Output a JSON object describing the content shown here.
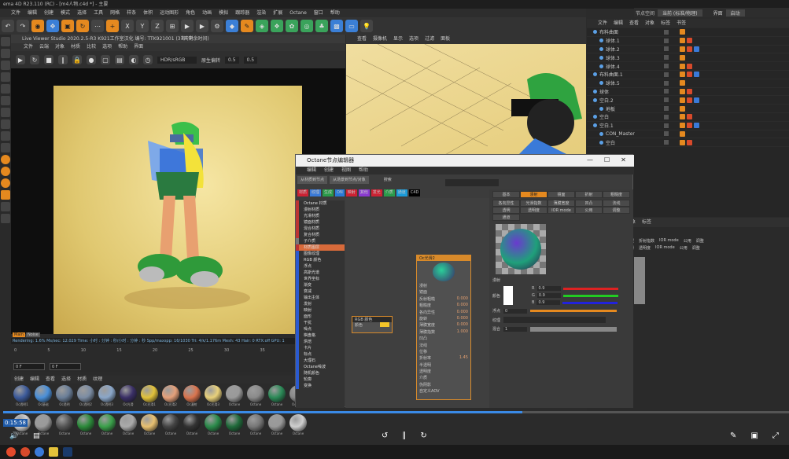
{
  "app_title": "ema 4D R23.110 (RC) - [m4人物.c4d *] - 主要",
  "menu": [
    "文件",
    "编辑",
    "创建",
    "模式",
    "选择",
    "工具",
    "网格",
    "样条",
    "体积",
    "运动图形",
    "角色",
    "动画",
    "模拟",
    "跟踪器",
    "渲染",
    "扩展",
    "Octane",
    "窗口",
    "帮助"
  ],
  "top_right": {
    "node_space_label": "节点空间",
    "node_space_value": "当前 (标准/物理)",
    "layout_label": "界面",
    "layout_value": "启动"
  },
  "lvs": {
    "title": "Live Viewer Studio 2020.2.5-R3  K921工作室汉化  编号: TTK921001  (37天剩余时间)",
    "menu": [
      "文件",
      "云端",
      "对象",
      "材质",
      "比较",
      "选项",
      "帮助",
      "界面"
    ],
    "toolbar": {
      "hint": "指令中",
      "color_mode": "HDR/sRGB",
      "mode_label": "原生偏转",
      "val1": "0.5",
      "val2": "0.5"
    },
    "noise_tags": [
      "Main",
      "Noise"
    ],
    "status": "Rendering: 1.6%   Ms/sec: 12.029   Time: 小时 : 分钟 : 秒/小时 : 分钟 : 秒   Spp/maxspp: 16/1030   Tri: 4/k/1.176m   Mesh: 43   Hair: 0   RTX:off   GPU: 1"
  },
  "timeline": {
    "ticks": [
      "0",
      "5",
      "10",
      "15",
      "20",
      "25",
      "30",
      "35",
      "40",
      "45"
    ],
    "frame_start": "0 F",
    "frame_cur": "0 F"
  },
  "mat_menu": [
    "创建",
    "编辑",
    "查看",
    "选择",
    "材质",
    "纹理"
  ],
  "materials": [
    {
      "name": "Oc透明1",
      "color": "#3c5a9a"
    },
    {
      "name": "Oc基础",
      "color": "#4a8fd8"
    },
    {
      "name": "Oc透明",
      "color": "#6a7e98"
    },
    {
      "name": "Oc透明2",
      "color": "#7b8ca3"
    },
    {
      "name": "Oc透明3",
      "color": "#8aa6c8"
    },
    {
      "name": "Oc光滑",
      "color": "#3a2f66"
    },
    {
      "name": "Oc光滑1",
      "color": "#e2c23a"
    },
    {
      "name": "Oc光滑2",
      "color": "#e5a07a"
    },
    {
      "name": "Oc漫射",
      "color": "#d9744e"
    },
    {
      "name": "Oc光滑3",
      "color": "#e8d07a"
    },
    {
      "name": "Octane",
      "color": "#9a9a9a"
    },
    {
      "name": "Octane",
      "color": "#8a8a8a"
    },
    {
      "name": "Octane",
      "color": "#2b8a57"
    },
    {
      "name": "Oc光滑4",
      "color": "#888"
    }
  ],
  "materials_row2": [
    {
      "name": "Octane",
      "color": "#cfcfcf"
    },
    {
      "name": "Octane",
      "color": "#9a9a9a"
    },
    {
      "name": "Octane",
      "color": "#555"
    },
    {
      "name": "Octane",
      "color": "#2b8a3a"
    },
    {
      "name": "Octane",
      "color": "#3aa04a"
    },
    {
      "name": "Octane",
      "color": "#aaa"
    },
    {
      "name": "Octane",
      "color": "#e8c070"
    },
    {
      "name": "Octane",
      "color": "#444"
    },
    {
      "name": "Octane",
      "color": "#333"
    },
    {
      "name": "Octane",
      "color": "#2a8a4a"
    },
    {
      "name": "Octane",
      "color": "#1f6a3a"
    },
    {
      "name": "Octane",
      "color": "#777"
    },
    {
      "name": "Octane",
      "color": "#999"
    },
    {
      "name": "Octane",
      "color": "#cfcfcf"
    }
  ],
  "viewport": {
    "menu": [
      "查看",
      "摄像机",
      "显示",
      "选项",
      "过滤",
      "面板"
    ]
  },
  "objects": {
    "tabs": [
      "文件",
      "编辑",
      "查看",
      "对象",
      "标签",
      "书签"
    ],
    "rows": [
      {
        "name": "布料曲面",
        "indent": 0
      },
      {
        "name": "球体.1",
        "indent": 1
      },
      {
        "name": "球体.2",
        "indent": 1
      },
      {
        "name": "球体.3",
        "indent": 1
      },
      {
        "name": "球体.4",
        "indent": 1
      },
      {
        "name": "布料曲面.1",
        "indent": 0
      },
      {
        "name": "球体.5",
        "indent": 1
      },
      {
        "name": "球体",
        "indent": 0
      },
      {
        "name": "空白.2",
        "indent": 0
      },
      {
        "name": "地板",
        "indent": 1
      },
      {
        "name": "空白",
        "indent": 0
      },
      {
        "name": "空白.1",
        "indent": 0
      },
      {
        "name": "CON_Master",
        "indent": 1
      },
      {
        "name": "空白",
        "indent": 1
      }
    ]
  },
  "attr_panel": {
    "tabs": [
      "基本",
      "坐标",
      "对象",
      "标签"
    ],
    "row1": [
      "模型",
      "折射指数",
      "IOR mode",
      "公用",
      "调整"
    ],
    "row2": [
      "漫射",
      "透明度",
      "IOR mode",
      "公用",
      "调整"
    ]
  },
  "node_editor": {
    "title": "Octane节点编辑器",
    "menu": [
      "编辑",
      "创建",
      "视图",
      "帮助"
    ],
    "buttons": [
      "从材质到节点",
      "从场景到节点/对象",
      "搜索"
    ],
    "tabs": [
      "材质",
      "纹理",
      "生成",
      "ON",
      "映射",
      "其他",
      "发光",
      "介质",
      "通道",
      "C4D"
    ],
    "categories": [
      "Octane 材质",
      "漫射材质",
      "光滑材质",
      "镜面材质",
      "混合材质",
      "复合材质",
      "子介质",
      "材质图层",
      "图像纹理",
      "RGB 颜色",
      "浮点",
      "高斯光谱",
      "世界坐标",
      "渐变",
      "衰减",
      "输出主体",
      "发射",
      "映射",
      "面形",
      "干扰",
      "噪点",
      "棋盘格",
      "烘焙",
      "卡片",
      "标点",
      "大理石",
      "Octane噪波",
      "随机颜色",
      "轮廓",
      "变换"
    ],
    "rgb_node": {
      "title": "RGB 颜色",
      "field": "颜色"
    },
    "main_node": {
      "title": "Oc光滑2",
      "rows": [
        "漫射",
        "镜面",
        "反射粗糙",
        "粗糙度",
        "各向异性",
        "旋转",
        "薄膜宽度",
        "薄膜指数",
        "凹凸",
        "法线",
        "位移",
        "折射率",
        "半透明",
        "透明度",
        "介质",
        "伪阴影",
        "自定义AOV"
      ],
      "values": [
        "",
        "",
        "0.000",
        "0.000",
        "0.000",
        "0.000",
        "0.000",
        "1.000",
        "",
        "",
        "",
        "1.45",
        "",
        "",
        "",
        "",
        ""
      ]
    },
    "right_tabs_row1": [
      "基本",
      "漫射",
      "镜面",
      "折射",
      "粗糙度"
    ],
    "right_tabs_row2": [
      "各向异性",
      "光滑指数",
      "薄膜宽度",
      "凹凸",
      "法线"
    ],
    "right_tabs_row3": [
      "透明",
      "透明度",
      "IOR mode",
      "公用",
      "调整"
    ],
    "right_tabs_row4": [
      "通道"
    ],
    "section": "漫射",
    "color_label": "颜色",
    "r": "0.9",
    "g": "0.9",
    "b": "0.9",
    "float_label": "浮点",
    "float_value": "0",
    "texture_label": "纹理",
    "mix_label": "混合",
    "mix_value": "1"
  },
  "player": {
    "time": "0:15:58",
    "speed_label": "倍速"
  },
  "colors": {
    "accent": "#e5891f",
    "blue": "#3b7fd6",
    "green": "#3aa35b"
  }
}
